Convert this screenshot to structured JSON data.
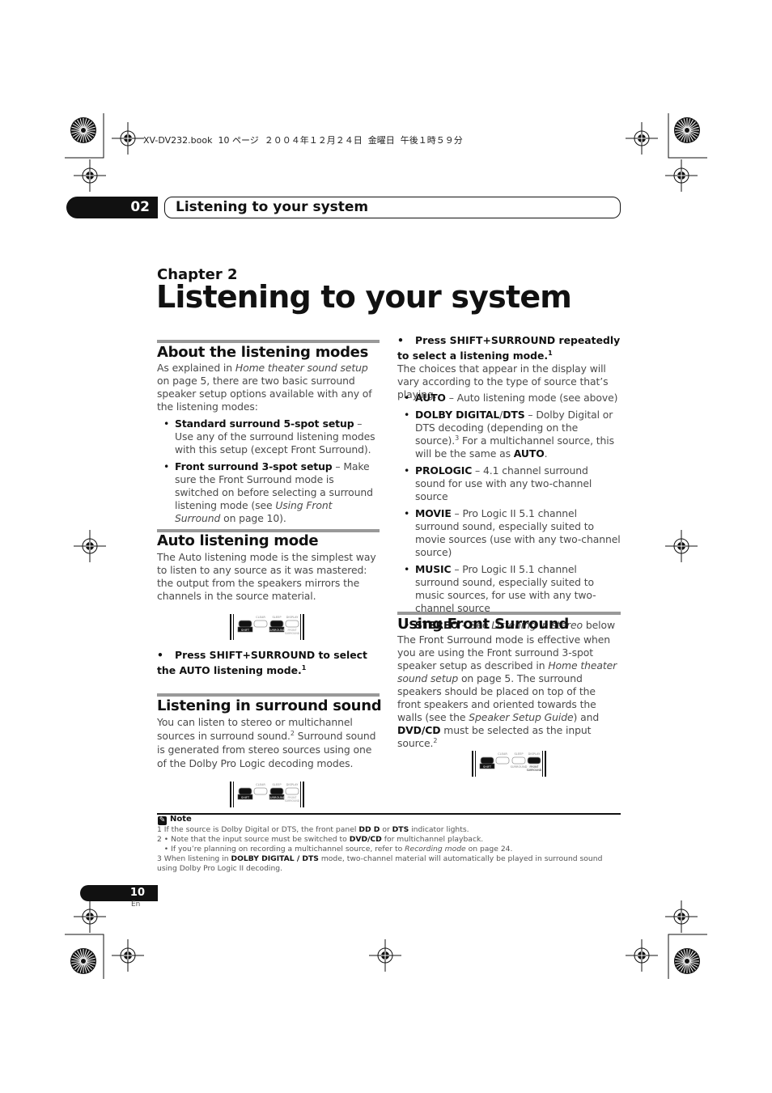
{
  "print_header": "XV-DV232.book  10 ページ  ２００４年１２月２４日  金曜日  午後１時５９分",
  "header": {
    "chapter_num": "02",
    "title": "Listening to your system"
  },
  "chapter_label": "Chapter 2",
  "page_title": "Listening to your system",
  "left": {
    "about": {
      "heading": "About the listening modes",
      "intro": [
        [
          "",
          "As explained in "
        ],
        [
          "i",
          "Home theater sound setup"
        ],
        [
          "",
          " on page 5, there are two basic surround speaker setup options available with any of the listening modes:"
        ]
      ],
      "bullets": [
        [
          [
            "b",
            "Standard surround 5-spot setup"
          ],
          [
            "",
            " – Use any of the surround listening modes with this setup (except Front Surround)."
          ]
        ],
        [
          [
            "b",
            "Front surround 3-spot setup"
          ],
          [
            "",
            " – Make sure the Front Surround mode is switched on before selecting a surround listening mode (see "
          ],
          [
            "i",
            "Using Front Surround"
          ],
          [
            "",
            " on page 10)."
          ]
        ]
      ]
    },
    "auto": {
      "heading": "Auto listening mode",
      "text": [
        [
          "",
          "The Auto listening mode is the simplest way to listen to any source as it was mastered: the output from the speakers mirrors the channels in the source material."
        ]
      ],
      "step": [
        [
          "",
          "Press SHIFT+SURROUND to select the AUTO listening mode."
        ],
        [
          "sup",
          "1"
        ]
      ]
    },
    "surround": {
      "heading": "Listening in surround sound",
      "text": [
        [
          "",
          "You can listen to stereo or multichannel sources in surround sound."
        ],
        [
          "sup",
          "2"
        ],
        [
          "",
          " Surround sound is generated from stereo sources using one of the Dolby Pro Logic decoding modes."
        ]
      ]
    }
  },
  "right": {
    "step": [
      [
        "",
        "Press SHIFT+SURROUND repeatedly to select a listening mode."
      ],
      [
        "sup",
        "1"
      ]
    ],
    "text": [
      [
        "",
        "The choices that appear in the display will vary according to the type of source that’s playing."
      ]
    ],
    "bullets": [
      [
        [
          "b",
          "AUTO"
        ],
        [
          "",
          " – Auto listening mode (see above)"
        ]
      ],
      [
        [
          "b",
          "DOLBY DIGITAL"
        ],
        [
          "",
          "/"
        ],
        [
          "b",
          "DTS"
        ],
        [
          "",
          " – Dolby Digital or DTS decoding (depending on the source)."
        ],
        [
          "sup",
          "3"
        ],
        [
          "",
          " For a multichannel source, this will be the same as "
        ],
        [
          "b",
          "AUTO"
        ],
        [
          "",
          "."
        ]
      ],
      [
        [
          "b",
          "PROLOGIC"
        ],
        [
          "",
          " – 4.1 channel surround sound for use with any two-channel source"
        ]
      ],
      [
        [
          "b",
          "MOVIE"
        ],
        [
          "",
          " – Pro Logic II 5.1 channel surround sound, especially suited to movie sources (use with any two-channel source)"
        ]
      ],
      [
        [
          "b",
          "MUSIC"
        ],
        [
          "",
          " – Pro Logic II 5.1 channel surround sound, especially suited to music sources, for use with any two-channel source"
        ]
      ],
      [
        [
          "b",
          "STEREO"
        ],
        [
          "",
          " – See "
        ],
        [
          "i",
          "Listening in stereo"
        ],
        [
          "",
          " below"
        ]
      ]
    ],
    "front": {
      "heading": "Using Front Surround",
      "text": [
        [
          "",
          "The Front Surround mode is effective when you are using the Front surround 3-spot speaker setup as described in "
        ],
        [
          "i",
          "Home theater sound setup"
        ],
        [
          "",
          " on page 5. The surround speakers should be placed on top of the front speakers and oriented towards the walls (see the "
        ],
        [
          "i",
          "Speaker Setup Guide"
        ],
        [
          "",
          ") and "
        ],
        [
          "b",
          "DVD/CD"
        ],
        [
          "",
          " must be selected as the input source."
        ],
        [
          "sup",
          "2"
        ]
      ]
    }
  },
  "remote": {
    "shift": "SHIFT",
    "clear": "CLEAR",
    "sleep": "SLEEP",
    "display": "DISPLAY",
    "surround": "SURROUND",
    "front_surround": "FRONT SURROUND"
  },
  "note": {
    "label": "Note",
    "lines": [
      [
        [
          "",
          "1 If the source is Dolby Digital or DTS, the front panel "
        ],
        [
          "b",
          "DD D"
        ],
        [
          "",
          " or "
        ],
        [
          "b",
          "DTS"
        ],
        [
          "",
          " indicator lights."
        ]
      ],
      [
        [
          "",
          "2 • Note that the input source must be switched to "
        ],
        [
          "b",
          "DVD/CD"
        ],
        [
          "",
          " for multichannel playback."
        ]
      ],
      [
        [
          "",
          "   • If you’re planning on recording a multichannel source, refer to "
        ],
        [
          "i",
          "Recording mode"
        ],
        [
          "",
          " on page 24."
        ]
      ],
      [
        [
          "",
          "3 When listening in "
        ],
        [
          "b",
          "DOLBY DIGITAL / DTS"
        ],
        [
          "",
          " mode, two-channel material will automatically be played in surround sound using Dolby Pro Logic II decoding."
        ]
      ]
    ]
  },
  "footer": {
    "page_number": "10",
    "lang": "En"
  }
}
